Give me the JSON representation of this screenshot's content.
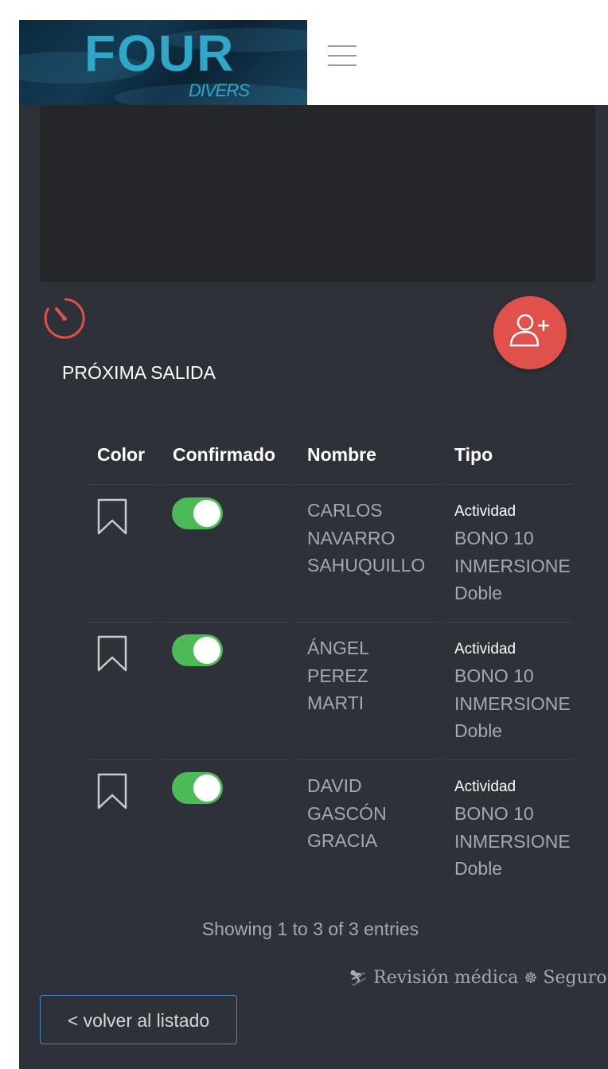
{
  "brand": {
    "logo_text": "FOUR",
    "logo_sub": "DIVERS"
  },
  "colors": {
    "panel": "#2f3139",
    "accent_red": "#e0514b",
    "toggle_on": "#4cbb57",
    "link_blue": "#3e8bd0",
    "muted_text": "#a3a8b2"
  },
  "icons": {
    "menu": "hamburger-icon",
    "timer": "stopwatch-icon",
    "add_user": "add-user-icon",
    "bookmark": "bookmark-icon"
  },
  "section": {
    "title": "PRÓXIMA SALIDA"
  },
  "table": {
    "headers": {
      "color": "Color",
      "confirmed": "Confirmado",
      "name": "Nombre",
      "type": "Tipo"
    },
    "rows": [
      {
        "confirmed": true,
        "name": [
          "CARLOS",
          "NAVARRO",
          "SAHUQUILLO"
        ],
        "type_label": "Actividad",
        "type_value": [
          "BONO 10",
          "INMERSIONE",
          "Doble"
        ]
      },
      {
        "confirmed": true,
        "name": [
          "ÁNGEL",
          "PEREZ",
          "MARTI"
        ],
        "type_label": "Actividad",
        "type_value": [
          "BONO 10",
          "INMERSIONE",
          "Doble"
        ]
      },
      {
        "confirmed": true,
        "name": [
          "DAVID",
          "GASCÓN",
          "GRACIA"
        ],
        "type_label": "Actividad",
        "type_value": [
          "BONO 10",
          "INMERSIONE",
          "Doble"
        ]
      }
    ],
    "info": "Showing 1 to 3 of 3 entries"
  },
  "footer": {
    "medical_icon": "user-md-icon",
    "medical": "Revisión médica",
    "insurance_icon": "life-ring-icon",
    "insurance": "Seguro"
  },
  "back_button": "< volver al listado"
}
